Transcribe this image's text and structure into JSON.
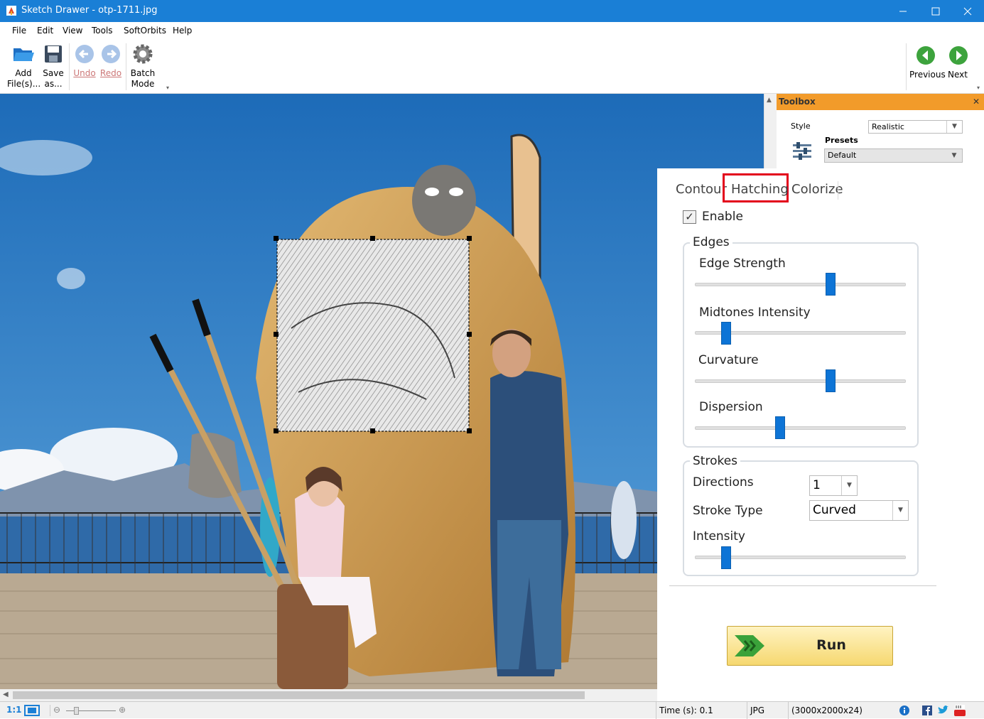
{
  "window": {
    "title": "Sketch Drawer - otp-1711.jpg"
  },
  "menu": [
    "File",
    "Edit",
    "View",
    "Tools",
    "SoftOrbits",
    "Help"
  ],
  "toolbar": {
    "add_l1": "Add",
    "add_l2": "File(s)...",
    "save_l1": "Save",
    "save_l2": "as...",
    "undo": "Undo",
    "redo": "Redo",
    "batch_l1": "Batch",
    "batch_l2": "Mode",
    "previous": "Previous",
    "next": "Next"
  },
  "toolbox": {
    "title": "Toolbox",
    "style_label": "Style",
    "style_value": "Realistic",
    "presets_label": "Presets",
    "presets_value": "Default"
  },
  "tabs": [
    "Contour",
    "Hatching",
    "Colorize"
  ],
  "active_tab": "Hatching",
  "enable": {
    "label": "Enable",
    "checked": true
  },
  "edges": {
    "title": "Edges",
    "sliders": [
      {
        "label": "Edge Strength",
        "value": 0.65
      },
      {
        "label": "Midtones Intensity",
        "value": 0.13
      },
      {
        "label": "Curvature",
        "value": 0.65
      },
      {
        "label": "Dispersion",
        "value": 0.4
      }
    ]
  },
  "strokes": {
    "title": "Strokes",
    "directions_label": "Directions",
    "directions_value": "1",
    "stroke_type_label": "Stroke Type",
    "stroke_type_value": "Curved",
    "intensity_label": "Intensity",
    "intensity_value": 0.13
  },
  "run_label": "Run",
  "status": {
    "zoom_label": "1:1",
    "time": "Time (s): 0.1",
    "format": "JPG",
    "dims": "(3000x2000x24)"
  },
  "colors": {
    "accent": "#1a7fd6",
    "toolbox_header": "#f29b2a",
    "slider": "#0d74d6",
    "highlight": "#e3001b"
  }
}
